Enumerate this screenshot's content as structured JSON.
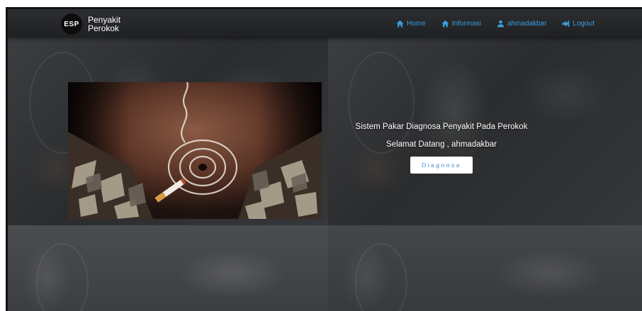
{
  "brand": {
    "logo_text": "ESP",
    "name_line1": "Penyakit",
    "name_line2": "Perokok"
  },
  "nav": {
    "items": [
      {
        "label": "Home",
        "icon": "home-icon"
      },
      {
        "label": "Informasi",
        "icon": "home-icon"
      },
      {
        "label": "ahmadakbar",
        "icon": "user-icon"
      },
      {
        "label": "Logout",
        "icon": "logout-icon"
      }
    ]
  },
  "hero": {
    "title": "Sistem Pakar Diagnosa Penyakit Pada Perokok",
    "welcome": "Selamat Datang , ahmadakbar",
    "button_label": "Diagnosa"
  },
  "colors": {
    "link": "#3a9ddf",
    "navbar": "#25272a",
    "background": "#2e3033"
  }
}
